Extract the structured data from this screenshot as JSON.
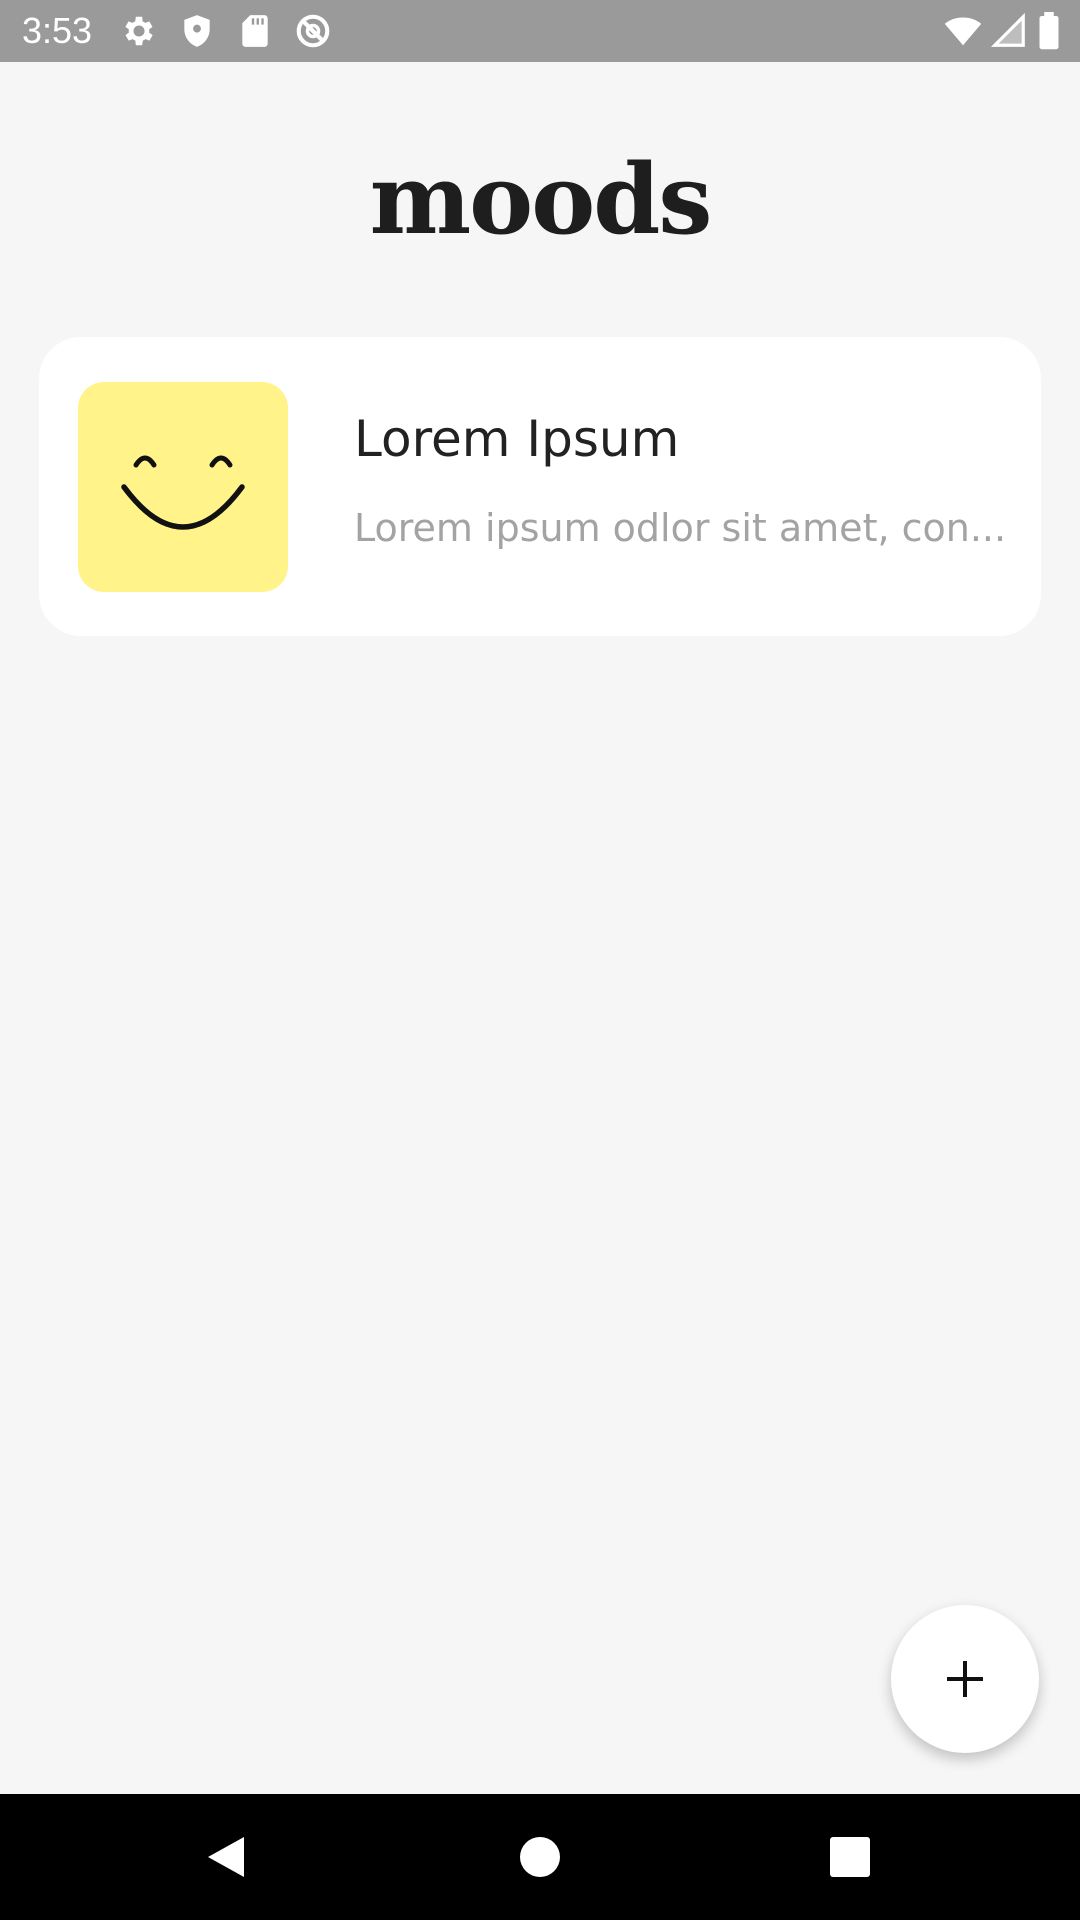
{
  "status_bar": {
    "time": "3:53",
    "icons": [
      "gear-icon",
      "shield-icon",
      "sd-card-icon",
      "no-sync-icon",
      "wifi-icon",
      "signal-icon",
      "battery-icon"
    ],
    "background": "#9a9a9a"
  },
  "app": {
    "title": "moods"
  },
  "moods": [
    {
      "title": "Lorem Ipsum",
      "description": "Lorem ipsum odlor sit amet, con...",
      "icon": "smiling-face-icon",
      "color": "#fff38a"
    }
  ],
  "fab": {
    "icon": "plus-icon"
  },
  "nav_bar": {
    "buttons": [
      "back-icon",
      "home-icon",
      "recents-icon"
    ]
  },
  "colors": {
    "background": "#f6f6f6",
    "card": "#ffffff",
    "title": "#1e1e1e",
    "secondary_text": "#a3a3a3"
  }
}
